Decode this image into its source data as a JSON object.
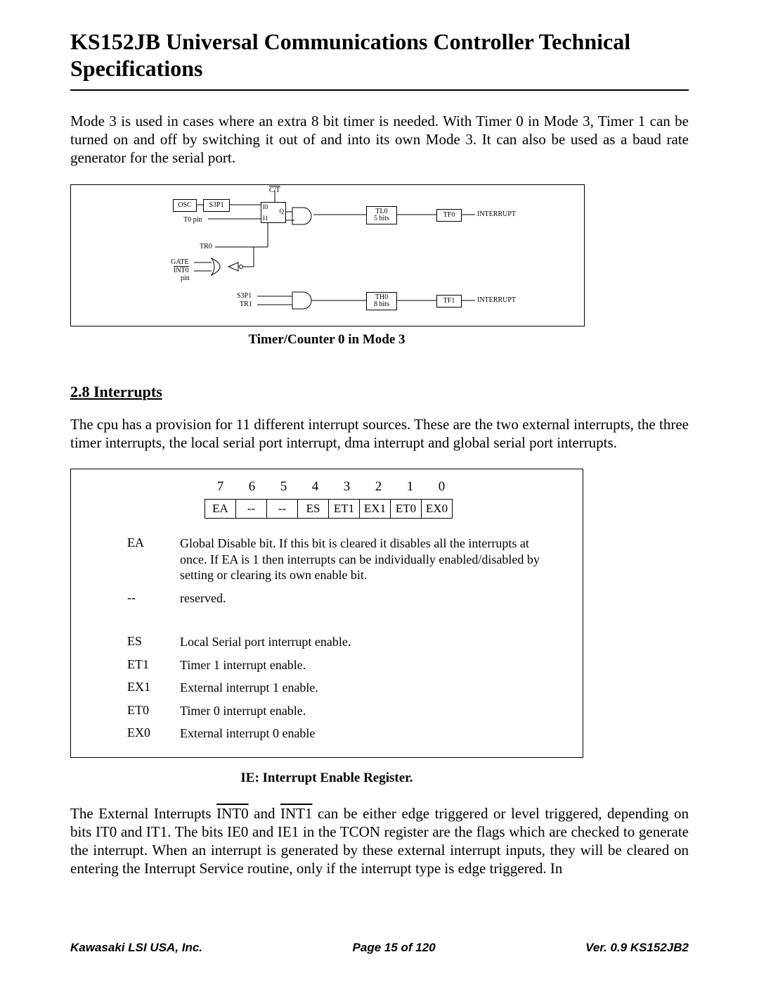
{
  "header": {
    "title": "KS152JB Universal Communications Controller Technical Specifications"
  },
  "intro_para": "Mode 3 is used in cases where an extra 8 bit timer is needed. With Timer 0 in Mode 3, Timer 1 can be turned on and off by switching it out of and into its own Mode 3. It can also be used as a baud rate generator for the serial port.",
  "diagram": {
    "caption": "Timer/Counter 0 in Mode 3",
    "labels": {
      "ct": "C/T",
      "osc": "OSC",
      "s3p1_a": "S3P1",
      "t0pin": "T0 pin",
      "i0": "I0",
      "i1": "I1",
      "q": "Q",
      "tr0": "TR0",
      "gate": "GATE",
      "int0": "INT0",
      "pin": "pin",
      "tl0": "TL0\n5 bits",
      "tf0": "TF0",
      "interrupt_a": "INTERRUPT",
      "s3p1_b": "S3P1",
      "tr1": "TR1",
      "th0": "TH0\n8 bits",
      "tf1": "TF1",
      "interrupt_b": "INTERRUPT"
    }
  },
  "section": {
    "heading": "2.8 Interrupts",
    "para": "The cpu has a provision for 11 different interrupt sources. These are the two external interrupts, the three timer interrupts, the local serial port interrupt, dma interrupt and global serial port interrupts."
  },
  "register": {
    "bits": [
      "7",
      "6",
      "5",
      "4",
      "3",
      "2",
      "1",
      "0"
    ],
    "cells": [
      "EA",
      "--",
      "--",
      "ES",
      "ET1",
      "EX1",
      "ET0",
      "EX0"
    ],
    "defs": [
      {
        "term": "EA",
        "desc": "Global Disable bit. If this bit is cleared it disables all the interrupts at once. If EA is 1 then interrupts can be individually enabled/disabled by setting or clearing its own enable bit."
      },
      {
        "term": "--",
        "desc": "reserved."
      },
      {
        "term": "ES",
        "desc": "Local Serial port interrupt enable."
      },
      {
        "term": "ET1",
        "desc": "Timer 1 interrupt enable."
      },
      {
        "term": "EX1",
        "desc": "External interrupt 1 enable."
      },
      {
        "term": "ET0",
        "desc": "Timer 0 interrupt enable."
      },
      {
        "term": "EX0",
        "desc": "External interrupt 0 enable"
      }
    ],
    "caption": "IE: Interrupt Enable Register."
  },
  "body_para_prefix": "The External Interrupts ",
  "body_para_int0": "INT0",
  "body_para_mid1": " and ",
  "body_para_int1": "INT1",
  "body_para_suffix": " can be either edge triggered or level triggered, depending on bits IT0 and IT1. The bits IE0 and IE1 in the TCON register are the flags which are checked to generate the interrupt. When an interrupt is generated by these external interrupt inputs, they will be cleared on entering the Interrupt Service routine, only if the interrupt type is edge triggered. In",
  "footer": {
    "left": "Kawasaki LSI USA, Inc.",
    "center": "Page 15 of 120",
    "right": "Ver.  0.9  KS152JB2"
  }
}
